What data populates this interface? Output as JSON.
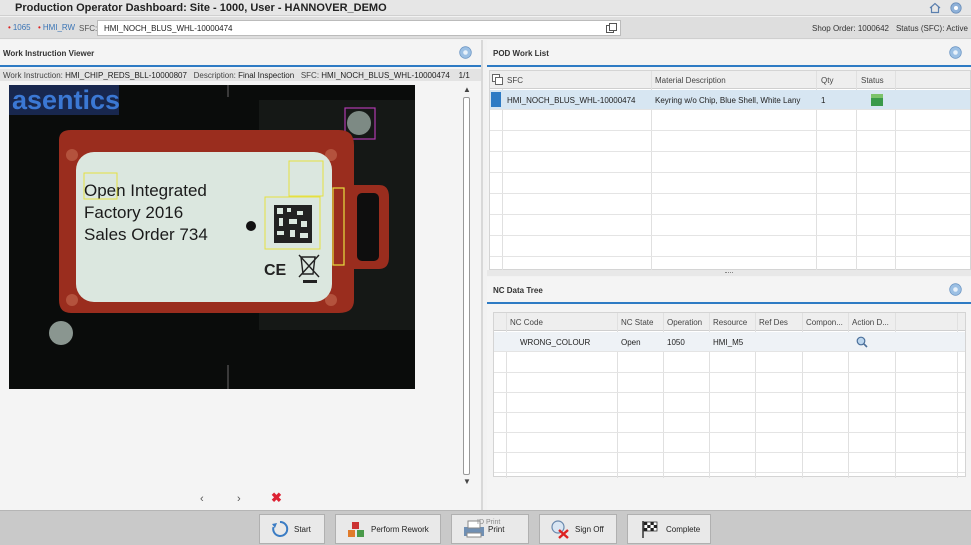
{
  "header": {
    "title": "Production Operator Dashboard: Site - 1000, User - HANNOVER_DEMO",
    "home_icon": "home-icon",
    "settings_icon": "settings-icon"
  },
  "subheader": {
    "resource": "1065",
    "operation": "HMI_RW",
    "sfc_label": "SFC:",
    "sfc_value": "HMI_NOCH_BLUS_WHL-10000474",
    "shop_order": "Shop Order:  1000642",
    "status": "Status (SFC):  Active"
  },
  "work_instruction": {
    "panel_title": "Work Instruction Viewer",
    "wi_label": "Work Instruction:",
    "wi_value": "HMI_CHIP_REDS_BLL-10000807",
    "desc_label": "Description:",
    "desc_value": "Final Inspection",
    "sfc_label": "SFC:",
    "sfc_value": "HMI_NOCH_BLUS_WHL-10000474",
    "page": "1/1",
    "image": {
      "brand": "asentics",
      "line1": "Open Integrated",
      "line2": "Factory 2016",
      "line3": "Sales Order 734",
      "ce_mark": "CE"
    },
    "nav": {
      "prev": "‹",
      "next": "›",
      "close": "✖"
    }
  },
  "pod_work_list": {
    "panel_title": "POD Work List",
    "columns": [
      "SFC",
      "Material Description",
      "Qty",
      "Status"
    ],
    "rows": [
      {
        "sfc": "HMI_NOCH_BLUS_WHL-10000474",
        "material": "Keyring w/o Chip, Blue Shell, White Lany",
        "qty": "1",
        "status_color": "#3a9a4a"
      }
    ]
  },
  "nc_data_tree": {
    "panel_title": "NC Data Tree",
    "columns": [
      "NC Code",
      "NC State",
      "Operation",
      "Resource",
      "Ref Des",
      "Compon...",
      "Action D..."
    ],
    "rows": [
      {
        "nc_code": "WRONG_COLOUR",
        "nc_state": "Open",
        "operation": "1050",
        "resource": "HMI_M5",
        "ref_des": "",
        "component": "",
        "action_icon": "magnifier-icon"
      }
    ]
  },
  "toolbar": {
    "start": "Start",
    "rework": "Perform Rework",
    "print": "Print",
    "print_overlay": "ID Print",
    "signoff": "Sign Off",
    "complete": "Complete"
  }
}
